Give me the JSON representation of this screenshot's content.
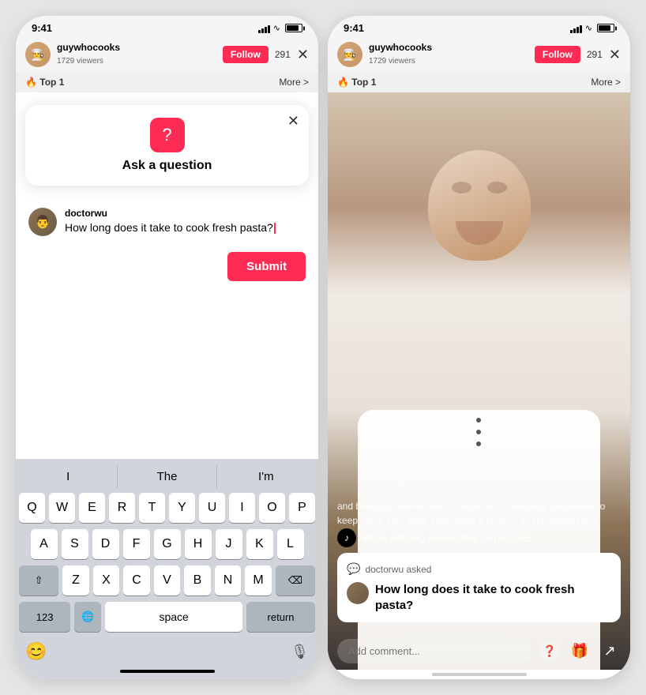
{
  "left_phone": {
    "status_time": "9:41",
    "top_bar": {
      "username": "guywhocooks",
      "viewers": "1729 viewers",
      "follow_label": "Follow",
      "viewer_count": "291",
      "close_symbol": "✕"
    },
    "banner": {
      "top_label": "🔥 Top 1",
      "more_label": "More >"
    },
    "modal": {
      "title": "Ask a question",
      "close_symbol": "✕"
    },
    "question": {
      "username": "doctorwu",
      "text": "How long does it take to cook fresh pasta?"
    },
    "submit_label": "Submit",
    "keyboard": {
      "suggestions": [
        "I",
        "The",
        "I'm"
      ],
      "row1": [
        "Q",
        "W",
        "E",
        "R",
        "T",
        "Y",
        "U",
        "I",
        "O",
        "P"
      ],
      "row2": [
        "A",
        "S",
        "D",
        "F",
        "G",
        "H",
        "J",
        "K",
        "L"
      ],
      "row3": [
        "Z",
        "X",
        "C",
        "V",
        "B",
        "N",
        "M"
      ],
      "key_123": "123",
      "key_space": "space",
      "key_return": "return"
    }
  },
  "right_phone": {
    "status_time": "9:41",
    "top_bar": {
      "username": "guywhocooks",
      "viewers": "1729 viewers",
      "follow_label": "Follow",
      "viewer_count": "291",
      "close_symbol": "✕"
    },
    "banner": {
      "top_label": "🔥 Top 1",
      "more_label": "More >"
    },
    "overlay_text": "and bring joy. Remember to follow our Community Guidelines to keep users safe while supporting a positive in-app experience.",
    "live_notification": "We're notifying viewers that you're LIVE!",
    "question_card": {
      "asked_by": "doctorwu asked",
      "question_text": "How long does it take to cook fresh pasta?"
    },
    "comment_placeholder": "Add comment...",
    "icons": {
      "question_mark": "?",
      "gift": "🎁",
      "share": "↗"
    }
  }
}
